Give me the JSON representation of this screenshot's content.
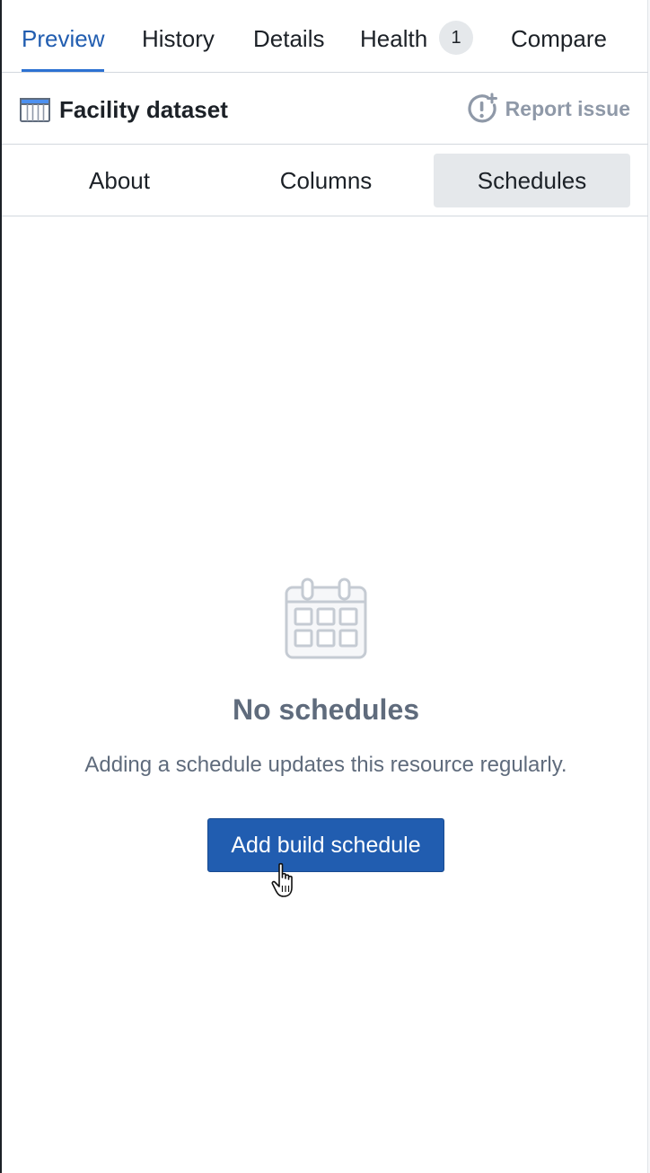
{
  "top_tabs": {
    "preview": "Preview",
    "history": "History",
    "details": "Details",
    "health": "Health",
    "health_count": "1",
    "compare": "Compare"
  },
  "header": {
    "icon": "table-icon",
    "title": "Facility dataset",
    "report_icon": "report-issue-icon",
    "report_label": "Report issue"
  },
  "sub_tabs": {
    "about": "About",
    "columns": "Columns",
    "schedules": "Schedules",
    "selected": "Schedules"
  },
  "empty_state": {
    "icon": "calendar-icon",
    "title": "No schedules",
    "description": "Adding a schedule updates this resource regularly.",
    "button_label": "Add build schedule"
  },
  "colors": {
    "accent": "#215db0",
    "muted_text": "#5f6b7c",
    "selected_tab_bg": "#e5e8eb"
  }
}
